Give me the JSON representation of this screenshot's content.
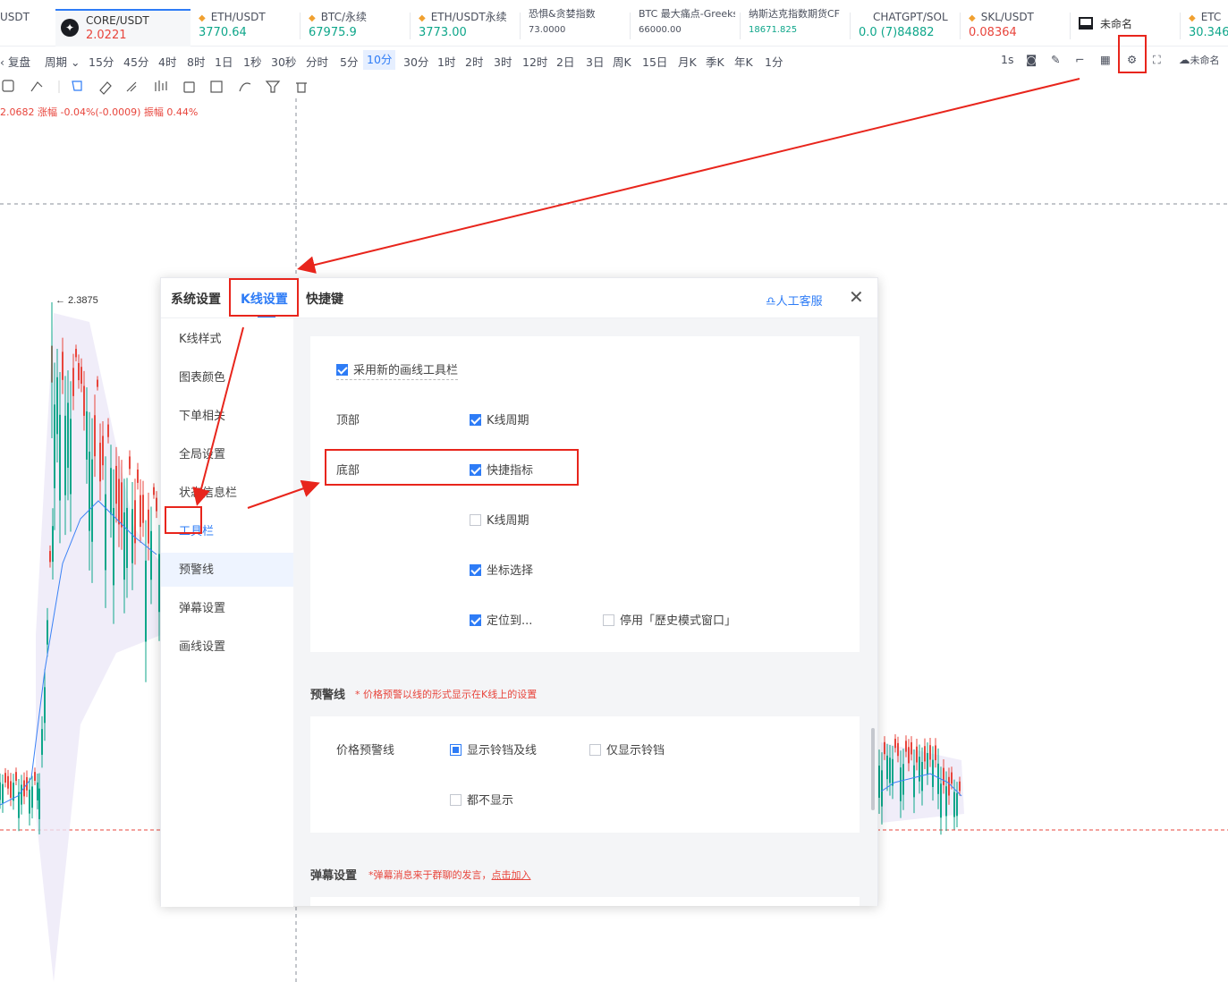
{
  "ticker": [
    {
      "name": "USDT",
      "price": ""
    },
    {
      "name": "CORE/USDT",
      "price": "2.0221"
    },
    {
      "name": "ETH/USDT",
      "price": "3770.64"
    },
    {
      "name": "BTC/永续",
      "price": "67975.9"
    },
    {
      "name": "ETH/USDT永续",
      "price": "3773.00"
    },
    {
      "name": "恐惧&贪婪指数",
      "price": "73.0000"
    },
    {
      "name": "BTC 最大痛点-Greeks",
      "price": "66000.00"
    },
    {
      "name": "纳斯达克指数期货CF",
      "price": "18671.825"
    },
    {
      "name": "CHATGPT/SOL",
      "price": "0.0 (7)84882"
    },
    {
      "name": "SKL/USDT",
      "price": "0.08364"
    },
    {
      "name": "未命名",
      "price": ""
    },
    {
      "name": "ETC",
      "price": "30.346"
    }
  ],
  "period_bar": {
    "left": [
      "复盘",
      "周期"
    ],
    "periods": [
      "15分",
      "45分",
      "4时",
      "8时",
      "1日",
      "1秒",
      "30秒",
      "分时",
      "5分",
      "10分",
      "30分",
      "1时",
      "2时",
      "3时",
      "12时",
      "2日",
      "3日",
      "周K",
      "15日",
      "月K",
      "季K",
      "年K",
      "1分"
    ],
    "selected": "10分",
    "right_interval": "1s",
    "layout_name": "未命名"
  },
  "info_line": "2.0682  涨幅 -0.04%(-0.0009)  振幅 0.44%",
  "chart": {
    "high_label": "← 2.3875"
  },
  "modal": {
    "tabs": [
      "系统设置",
      "K线设置",
      "快捷键"
    ],
    "active_tab": "K线设置",
    "service": "人工客服",
    "sidebar": [
      "K线样式",
      "图表颜色",
      "下单相关",
      "全局设置",
      "状态信息栏",
      "工具栏",
      "预警线",
      "弹幕设置",
      "画线设置"
    ],
    "active_sidebar": "工具栏",
    "toolbar_card": {
      "new_tool": "采用新的画线工具栏",
      "top_label": "顶部",
      "top_kline": "K线周期",
      "bottom_label": "底部",
      "bottom_quick": "快捷指标",
      "bottom_kline": "K线周期",
      "coord": "坐标选择",
      "locate": "定位到...",
      "history": "停用「歷史模式窗口」"
    },
    "alert": {
      "title": "预警线",
      "note": "* 价格预警以线的形式显示在K线上的设置",
      "label": "价格预警线",
      "opt1": "显示铃铛及线",
      "opt2": "仅显示铃铛",
      "opt3": "都不显示"
    },
    "barrage": {
      "title": "弹幕设置",
      "note": "*弹幕消息来于群聊的发言，",
      "link": "点击加入"
    }
  },
  "colors": {
    "accent": "#2e7cf6",
    "up": "#0ea68a",
    "down": "#e8453c",
    "annotation": "#e8251c"
  }
}
